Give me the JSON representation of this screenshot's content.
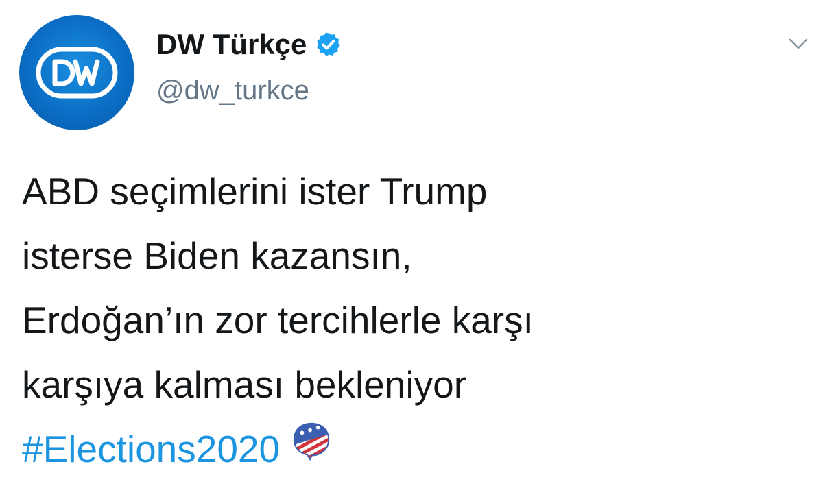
{
  "account": {
    "avatar_logo_text": "DW",
    "display_name": "DW Türkçe",
    "handle": "@dw_turkce",
    "verified": true
  },
  "icons": {
    "verified": "verified-badge-icon",
    "caret": "chevron-down-icon",
    "hashflag": "us-election-hashflag-icon",
    "avatar": "dw-logo-icon"
  },
  "tweet": {
    "lines": [
      "ABD seçimlerini ister Trump",
      "isterse Biden kazansın,",
      "Erdoğan’ın zor tercihlerle karşı",
      "karşıya kalması bekleniyor"
    ],
    "hashtag": "#Elections2020"
  },
  "colors": {
    "verified_blue": "#1da1f2",
    "hashtag_blue": "#1b95e0",
    "handle_gray": "#657786",
    "text": "#14171a",
    "avatar_blue": "#0a6cc2"
  }
}
